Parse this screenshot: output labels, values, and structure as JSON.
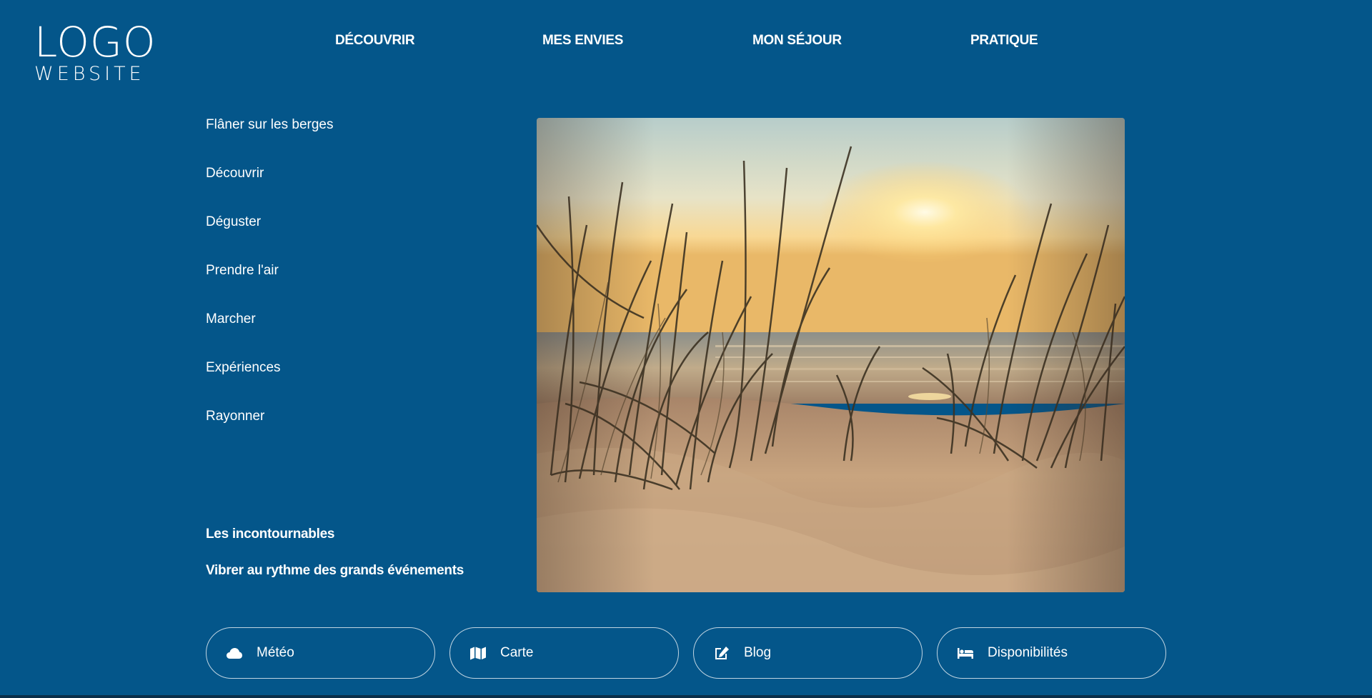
{
  "logo": {
    "line1": "LOGO",
    "line2": "WEBSITE"
  },
  "nav": {
    "items": [
      {
        "label": "DÉCOUVRIR"
      },
      {
        "label": "MES ENVIES"
      },
      {
        "label": "MON SÉJOUR"
      },
      {
        "label": "PRATIQUE"
      }
    ]
  },
  "submenu": {
    "items": [
      {
        "label": "Flâner sur les berges"
      },
      {
        "label": "Découvrir"
      },
      {
        "label": "Déguster"
      },
      {
        "label": "Prendre l'air"
      },
      {
        "label": "Marcher"
      },
      {
        "label": "Expériences"
      },
      {
        "label": "Rayonner"
      }
    ],
    "highlights": [
      {
        "label": "Les incontournables"
      },
      {
        "label": "Vibrer au rythme des grands événements"
      }
    ]
  },
  "hero": {
    "icon": "beach-sunset-photo"
  },
  "quick_links": [
    {
      "label": "Météo",
      "icon": "cloud-icon"
    },
    {
      "label": "Carte",
      "icon": "map-icon"
    },
    {
      "label": "Blog",
      "icon": "edit-icon"
    },
    {
      "label": "Disponibilités",
      "icon": "bed-icon"
    }
  ],
  "colors": {
    "background": "#04568a",
    "text": "#ffffff"
  }
}
